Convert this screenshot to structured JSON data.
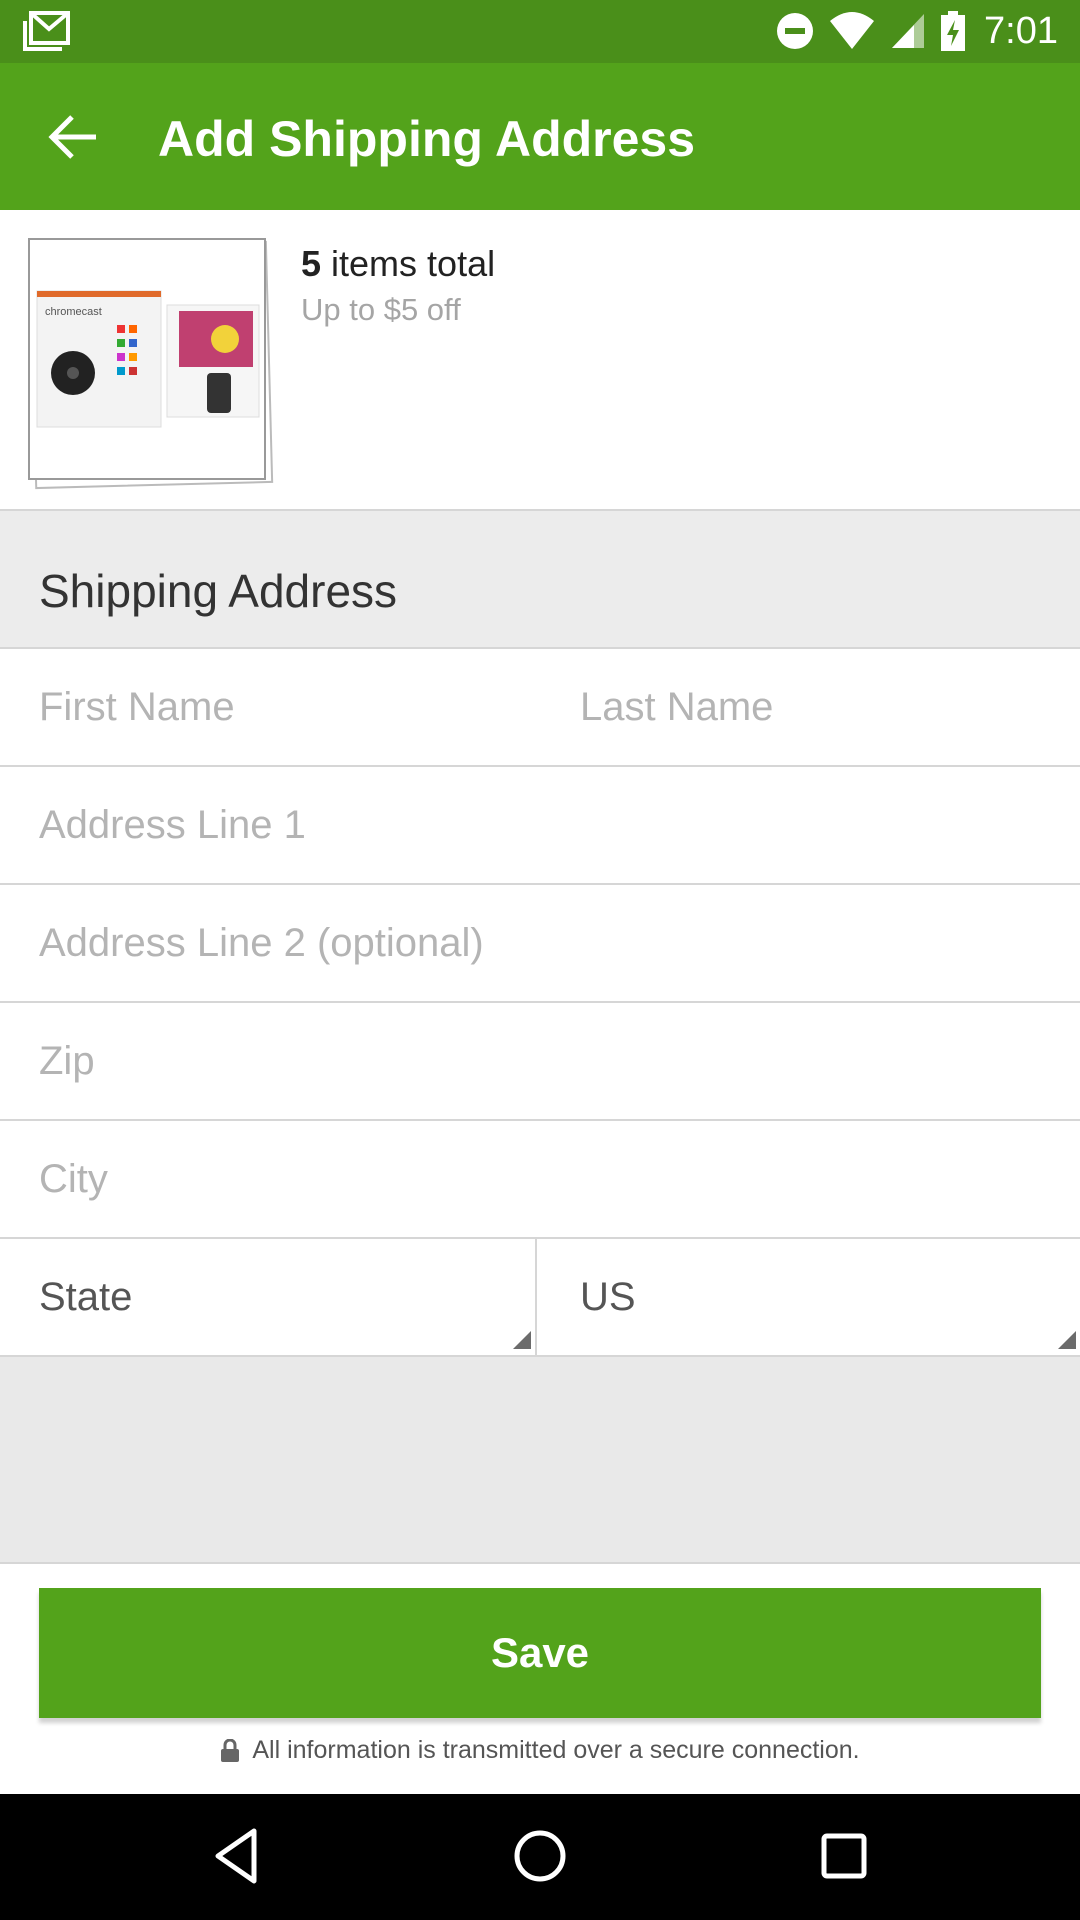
{
  "status_bar": {
    "time": "7:01",
    "icons": [
      "gmail-notification-icon",
      "do-not-disturb-icon",
      "wifi-icon",
      "cell-signal-icon",
      "battery-charging-icon"
    ]
  },
  "app_bar": {
    "title": "Add Shipping Address",
    "back_icon": "arrow-left-icon"
  },
  "order_summary": {
    "item_count": "5",
    "items_suffix": " items total",
    "discount": "Up to $5 off",
    "product_label": "chromecast"
  },
  "section": {
    "title": "Shipping Address"
  },
  "form": {
    "first_name": {
      "placeholder": "First Name",
      "value": ""
    },
    "last_name": {
      "placeholder": "Last Name",
      "value": ""
    },
    "address1": {
      "placeholder": "Address Line 1",
      "value": ""
    },
    "address2": {
      "placeholder": "Address Line 2 (optional)",
      "value": ""
    },
    "zip": {
      "placeholder": "Zip",
      "value": ""
    },
    "city": {
      "placeholder": "City",
      "value": ""
    },
    "state": {
      "selected": "State"
    },
    "country": {
      "selected": "US"
    }
  },
  "footer": {
    "save_label": "Save",
    "secure_note": "All information is transmitted over a secure connection.",
    "lock_icon": "lock-icon"
  },
  "nav_bar": {
    "icons": [
      "back-triangle-icon",
      "home-circle-icon",
      "recents-square-icon"
    ]
  },
  "colors": {
    "status_bar": "#4a8f1a",
    "app_bar": "#53a31b",
    "button": "#53a31b",
    "placeholder": "#b4b4b4",
    "divider": "#d6d6d6"
  }
}
